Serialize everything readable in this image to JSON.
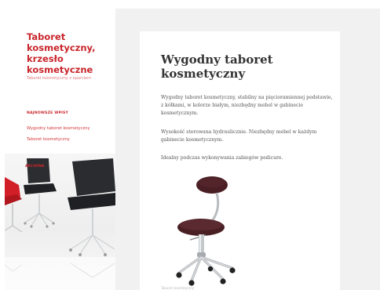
{
  "site": {
    "title": "Taboret kosmetyczny, krzesło kosmetyczne",
    "description": "Taboret kosmetyczny z oparciem"
  },
  "sidebar": {
    "widget_title": "NAJNOWSZE WPISY",
    "links": [
      "Wygodny taboret kosmetyczny",
      "Taboret kosmetyczny"
    ],
    "photo_label": "ARCHIWA"
  },
  "article": {
    "title": "Wygodny taboret kosmetyczny",
    "paragraphs": [
      "Wygodny taboret kosmetyczny, stabilny na pięcioramiennej podstawie, z kółkami, w kolorze białym, niezbędny mebel w gabinecie kosmetycznym.",
      "Wysokość sterowana hydraulicznie. Niezbędny mebel w każdym gabinecie kosmetycznym.",
      "Idealny podczas wykonywania zabiegów pedicure."
    ],
    "caption": "Taboret kosmetyczny"
  },
  "colors": {
    "accent": "#c9262c",
    "main_background": "#f1f1f1",
    "stool_seat": "#4a1f24",
    "chrome": "#b9bcc0"
  }
}
